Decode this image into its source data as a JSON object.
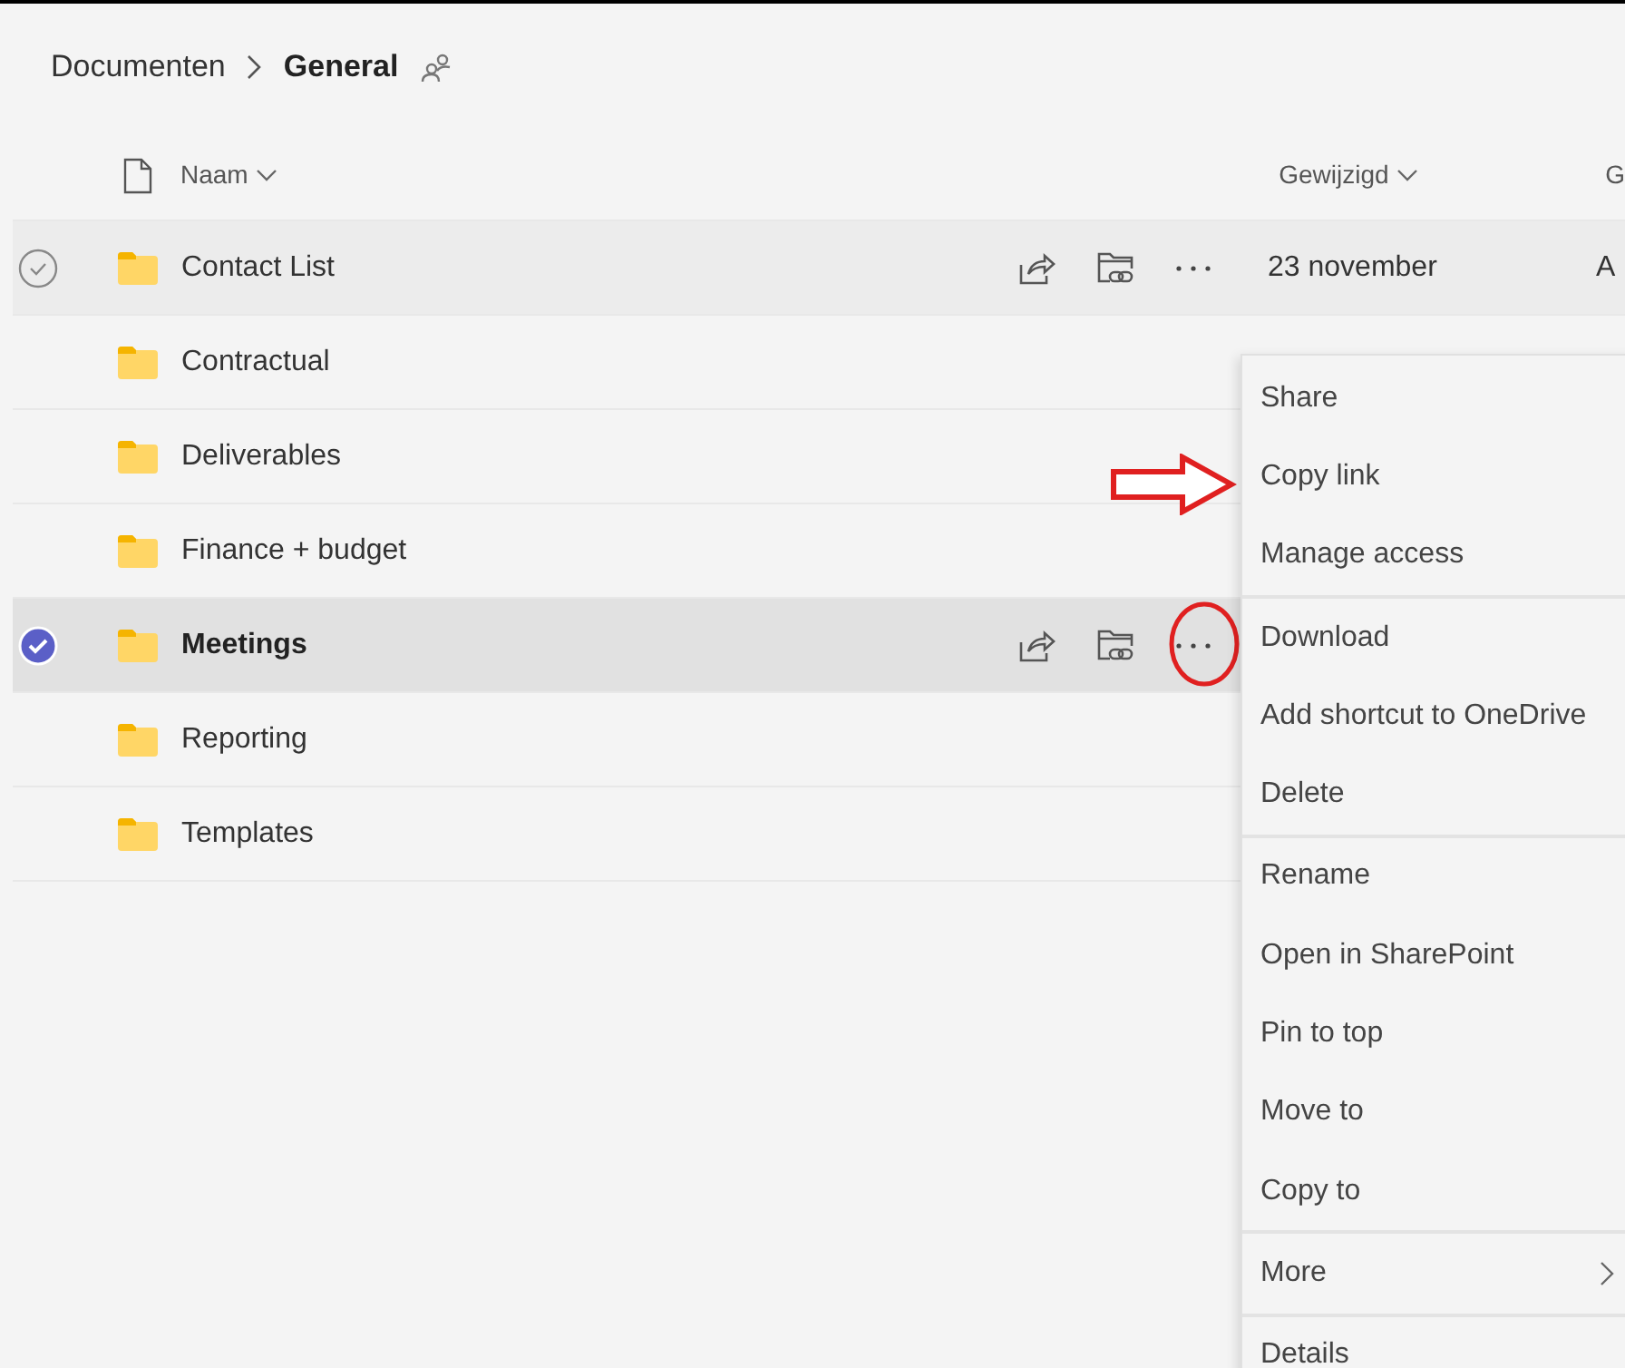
{
  "breadcrumb": {
    "parent": "Documenten",
    "current": "General"
  },
  "columns": {
    "name": "Naam",
    "modified": "Gewijzigd",
    "column_3": "G"
  },
  "rows": [
    {
      "name": "Contact List",
      "selected": false,
      "hovered": true,
      "modified": "23 november",
      "column_3": "A"
    },
    {
      "name": "Contractual",
      "selected": false,
      "hovered": false
    },
    {
      "name": "Deliverables",
      "selected": false,
      "hovered": false
    },
    {
      "name": "Finance + budget",
      "selected": false,
      "hovered": false
    },
    {
      "name": "Meetings",
      "selected": true,
      "hovered": false
    },
    {
      "name": "Reporting",
      "selected": false,
      "hovered": false
    },
    {
      "name": "Templates",
      "selected": false,
      "hovered": false
    }
  ],
  "context_menu": {
    "groups": [
      [
        {
          "label": "Share",
          "kind": "item"
        },
        {
          "label": "Copy link",
          "kind": "item"
        },
        {
          "label": "Manage access",
          "kind": "item"
        }
      ],
      [
        {
          "label": "Download",
          "kind": "item"
        },
        {
          "label": "Add shortcut to OneDrive",
          "kind": "item"
        },
        {
          "label": "Delete",
          "kind": "item"
        }
      ],
      [
        {
          "label": "Rename",
          "kind": "item"
        },
        {
          "label": "Open in SharePoint",
          "kind": "item"
        },
        {
          "label": "Pin to top",
          "kind": "item"
        },
        {
          "label": "Move to",
          "kind": "item"
        },
        {
          "label": "Copy to",
          "kind": "item"
        }
      ],
      [
        {
          "label": "More",
          "kind": "submenu"
        }
      ],
      [
        {
          "label": "Details",
          "kind": "item"
        }
      ]
    ]
  }
}
